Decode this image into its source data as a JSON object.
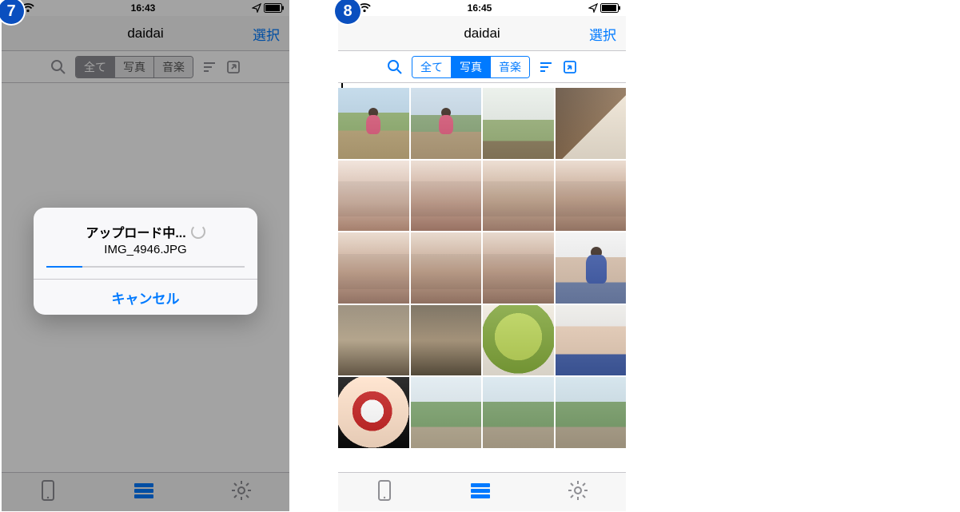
{
  "step_left": "7",
  "step_right": "8",
  "statusbar": {
    "time_left": "16:43",
    "time_right": "16:45"
  },
  "nav": {
    "title": "daidai",
    "select_label": "選択"
  },
  "segments": {
    "all": "全て",
    "photos": "写真",
    "music": "音楽"
  },
  "alert": {
    "title": "アップロード中...",
    "filename": "IMG_4946.JPG",
    "cancel": "キャンセル",
    "progress_pct": 18
  },
  "grid": {
    "thumbs": [
      "p-outdoor fig fig-kid",
      "p-outdoor2 fig fig-kid",
      "p-playground",
      "p-table",
      "p-group1 fig fig-grp",
      "p-group2 fig fig-grp",
      "p-group3 fig fig-grp",
      "p-group4 fig fig-grp",
      "p-group5 fig fig-grp",
      "p-group6 fig fig-grp",
      "p-group7 fig fig-grp",
      "p-portrait fig fig-man",
      "p-indoor",
      "p-indoor2",
      "p-food",
      "p-selfie",
      "p-mask",
      "p-park1",
      "p-park2",
      "p-park3"
    ]
  },
  "colors": {
    "accent": "#007aff",
    "badge": "#0a4fbf"
  }
}
